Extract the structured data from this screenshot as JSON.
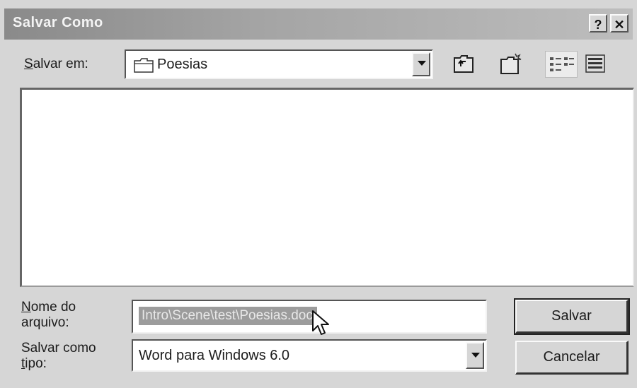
{
  "dialog": {
    "title": "Salvar Como",
    "help_label": "?",
    "close_label": "✕"
  },
  "location": {
    "label_accel": "S",
    "label_rest": "alvar em:",
    "value": "Poesias"
  },
  "filename": {
    "label_line1_accel": "N",
    "label_line1_rest": "ome do",
    "label_line2": "arquivo:",
    "value": "Intro\\Scene\\test\\Poesias.doc"
  },
  "filetype": {
    "label_line1": "Salvar como",
    "label_line2_accel": "t",
    "label_line2_rest": "ipo:",
    "value": "Word para Windows 6.0"
  },
  "buttons": {
    "save": "Salvar",
    "cancel": "Cancelar"
  },
  "colors": {
    "titlebar": "#9a9a9a",
    "face": "#d6d6d6"
  }
}
